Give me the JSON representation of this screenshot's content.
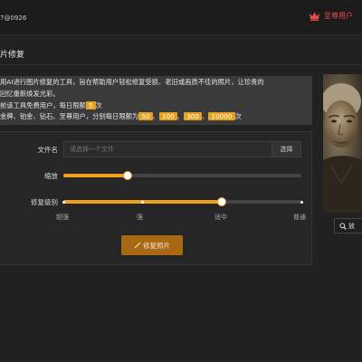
{
  "header": {
    "user_id": "7@0926",
    "vip_label": "至尊用户"
  },
  "section": {
    "title": "片修复"
  },
  "info": {
    "line1": "用AI进行图片修复的工具，旨在帮助用户轻松修复受损、老旧或画质不佳的照片，让珍贵的",
    "line2": "回忆重新焕发光彩。",
    "line3_prefix": "前该工具免费用户，每日限额",
    "free_limit": "5",
    "line3_suffix": "次",
    "line4_prefix": "金牌、铂金、钻石、至尊用户，分别每日限额为",
    "limits": [
      "50",
      "100",
      "300",
      "10000"
    ],
    "sep": "、",
    "line4_suffix": "次"
  },
  "form": {
    "file_label": "文件名",
    "file_placeholder": "请选择一个文件",
    "select_button": "选择",
    "zoom_label": "缩放",
    "zoom_value": 0.27,
    "level_label": "修复级别",
    "level_options": [
      "超强",
      "强",
      "适中",
      "普通"
    ],
    "level_selected": "适中",
    "submit_button": "修复照片"
  },
  "preview": {
    "zoom_button": "放"
  },
  "colors": {
    "accent": "#f0a01c",
    "vip": "#e84a4a",
    "button": "#a86814"
  },
  "icons": {
    "vip": "crown-icon",
    "submit": "wand-icon",
    "zoom": "zoom-in-icon"
  }
}
